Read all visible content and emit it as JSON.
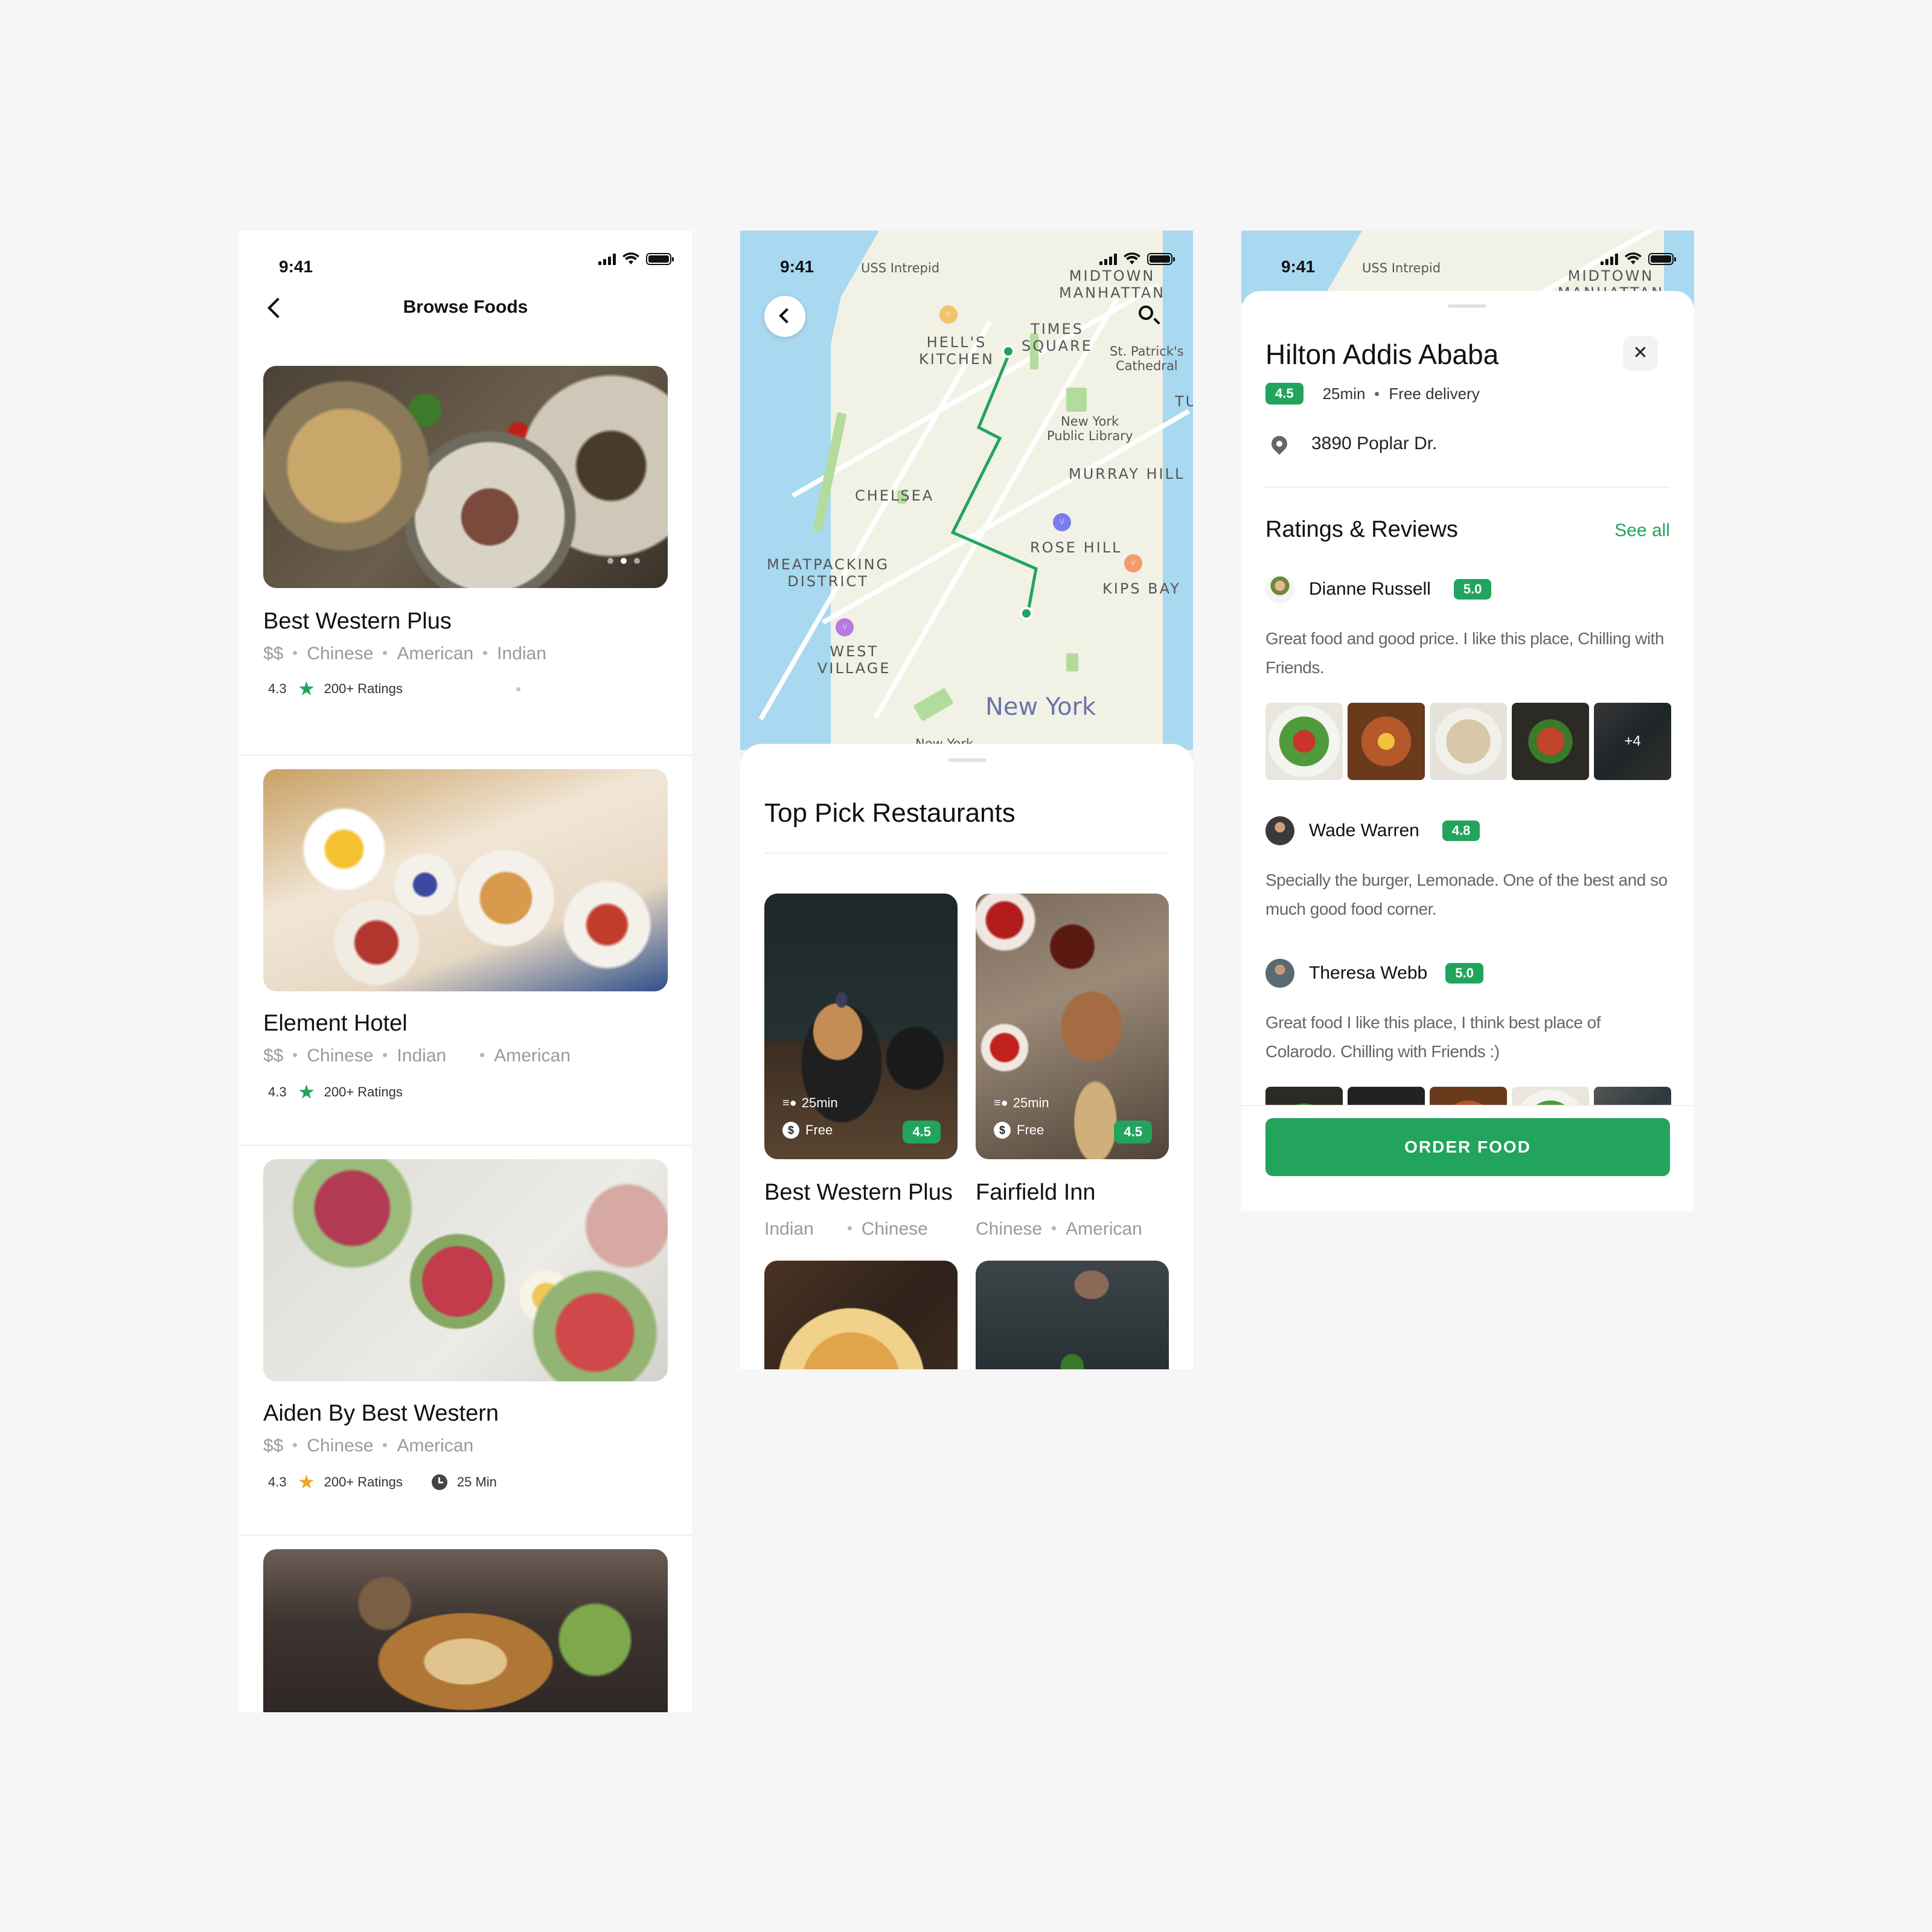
{
  "colors": {
    "accent": "#22A45D",
    "star_green": "#22A45D",
    "star_orange": "#F3A52B",
    "text_primary": "#111111",
    "text_secondary": "#9A9A9A"
  },
  "status_bar": {
    "time": "9:41"
  },
  "browse": {
    "title": "Browse Foods",
    "back_icon": "chevron-left-icon",
    "restaurants": [
      {
        "name": "Best Western Plus",
        "price": "$$",
        "cuisines": [
          "Chinese",
          "American",
          "Indian"
        ],
        "rating": "4.3",
        "ratings_count": "200+ Ratings",
        "star": "green"
      },
      {
        "name": "Element Hotel",
        "price": "$$",
        "cuisines": [
          "Chinese",
          "Indian",
          "American"
        ],
        "rating": "4.3",
        "ratings_count": "200+ Ratings",
        "star": "green"
      },
      {
        "name": "Aiden By Best Western",
        "price": "$$",
        "cuisines": [
          "Chinese",
          "American"
        ],
        "rating": "4.3",
        "ratings_count": "200+ Ratings",
        "star": "orange",
        "delivery_time": "25 Min"
      }
    ]
  },
  "map": {
    "labels": {
      "uss_intrepid": "USS Intrepid",
      "midtown": "MIDTOWN\nMANHATTAN",
      "hells_kitchen": "HELL'S\nKITCHEN",
      "times_square": "TIMES\nSQUARE",
      "st_patricks": "St. Patrick's\nCathedral",
      "tu": "TU",
      "library": "New York\nPublic Library",
      "murray_hill": "MURRAY HILL",
      "chelsea": "CHELSEA",
      "rose_hill": "ROSE HILL",
      "meatpacking": "MEATPACKING\nDISTRICT",
      "kips_bay": "KIPS BAY",
      "west_village": "WEST\nVILLAGE",
      "new_york": "New York",
      "new_york_small": "New York"
    }
  },
  "top_picks": {
    "title": "Top Pick Restaurants",
    "cards": [
      {
        "name": "Best Western Plus",
        "cuisines": [
          "Indian",
          "Chinese"
        ],
        "time": "25min",
        "delivery": "Free",
        "rating": "4.5"
      },
      {
        "name": "Fairfield Inn",
        "cuisines": [
          "Chinese",
          "American"
        ],
        "time": "25min",
        "delivery": "Free",
        "rating": "4.5"
      }
    ]
  },
  "detail": {
    "name": "Hilton Addis Ababa",
    "rating": "4.5",
    "time": "25min",
    "delivery": "Free delivery",
    "address": "3890 Poplar Dr.",
    "reviews_title": "Ratings & Reviews",
    "see_all": "See all",
    "more_photos": "+4",
    "reviews": [
      {
        "name": "Dianne Russell",
        "rating": "5.0",
        "text": "Great food and good price. I like this place, Chilling with Friends."
      },
      {
        "name": "Wade Warren",
        "rating": "4.8",
        "text": "Specially the burger, Lemonade. One of the best and so much good food corner."
      },
      {
        "name": "Theresa Webb",
        "rating": "5.0",
        "text": "Great food I like this place, I think best place of Colarodo. Chilling with Friends :)"
      }
    ],
    "order_button": "ORDER FOOD"
  }
}
